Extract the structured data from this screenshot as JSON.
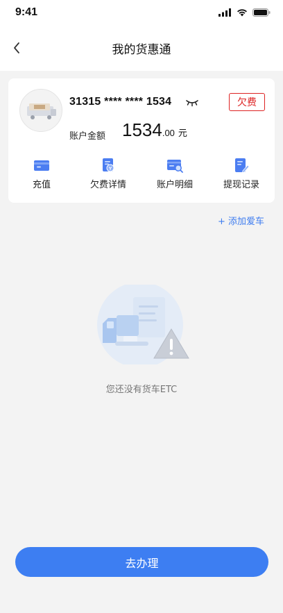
{
  "status_bar": {
    "time": "9:41"
  },
  "nav": {
    "title": "我的货惠通"
  },
  "account": {
    "card_number": "31315 **** **** 1534",
    "status_badge": "欠费",
    "balance_label": "账户金额",
    "balance_integer": "1534",
    "balance_decimal": ".00",
    "balance_unit": "元"
  },
  "actions": [
    {
      "label": "充值",
      "icon": "recharge-card-icon"
    },
    {
      "label": "欠费详情",
      "icon": "arrears-doc-icon"
    },
    {
      "label": "账户明细",
      "icon": "account-detail-icon"
    },
    {
      "label": "提现记录",
      "icon": "withdraw-record-icon"
    }
  ],
  "add_car": {
    "label": "+ 添加爱车"
  },
  "empty_state": {
    "text": "您还没有货车ETC"
  },
  "primary_button": {
    "label": "去办理"
  },
  "colors": {
    "accent": "#3d7ef2",
    "link": "#3f7df0",
    "warning": "#d22222",
    "background": "#f3f3f3"
  }
}
